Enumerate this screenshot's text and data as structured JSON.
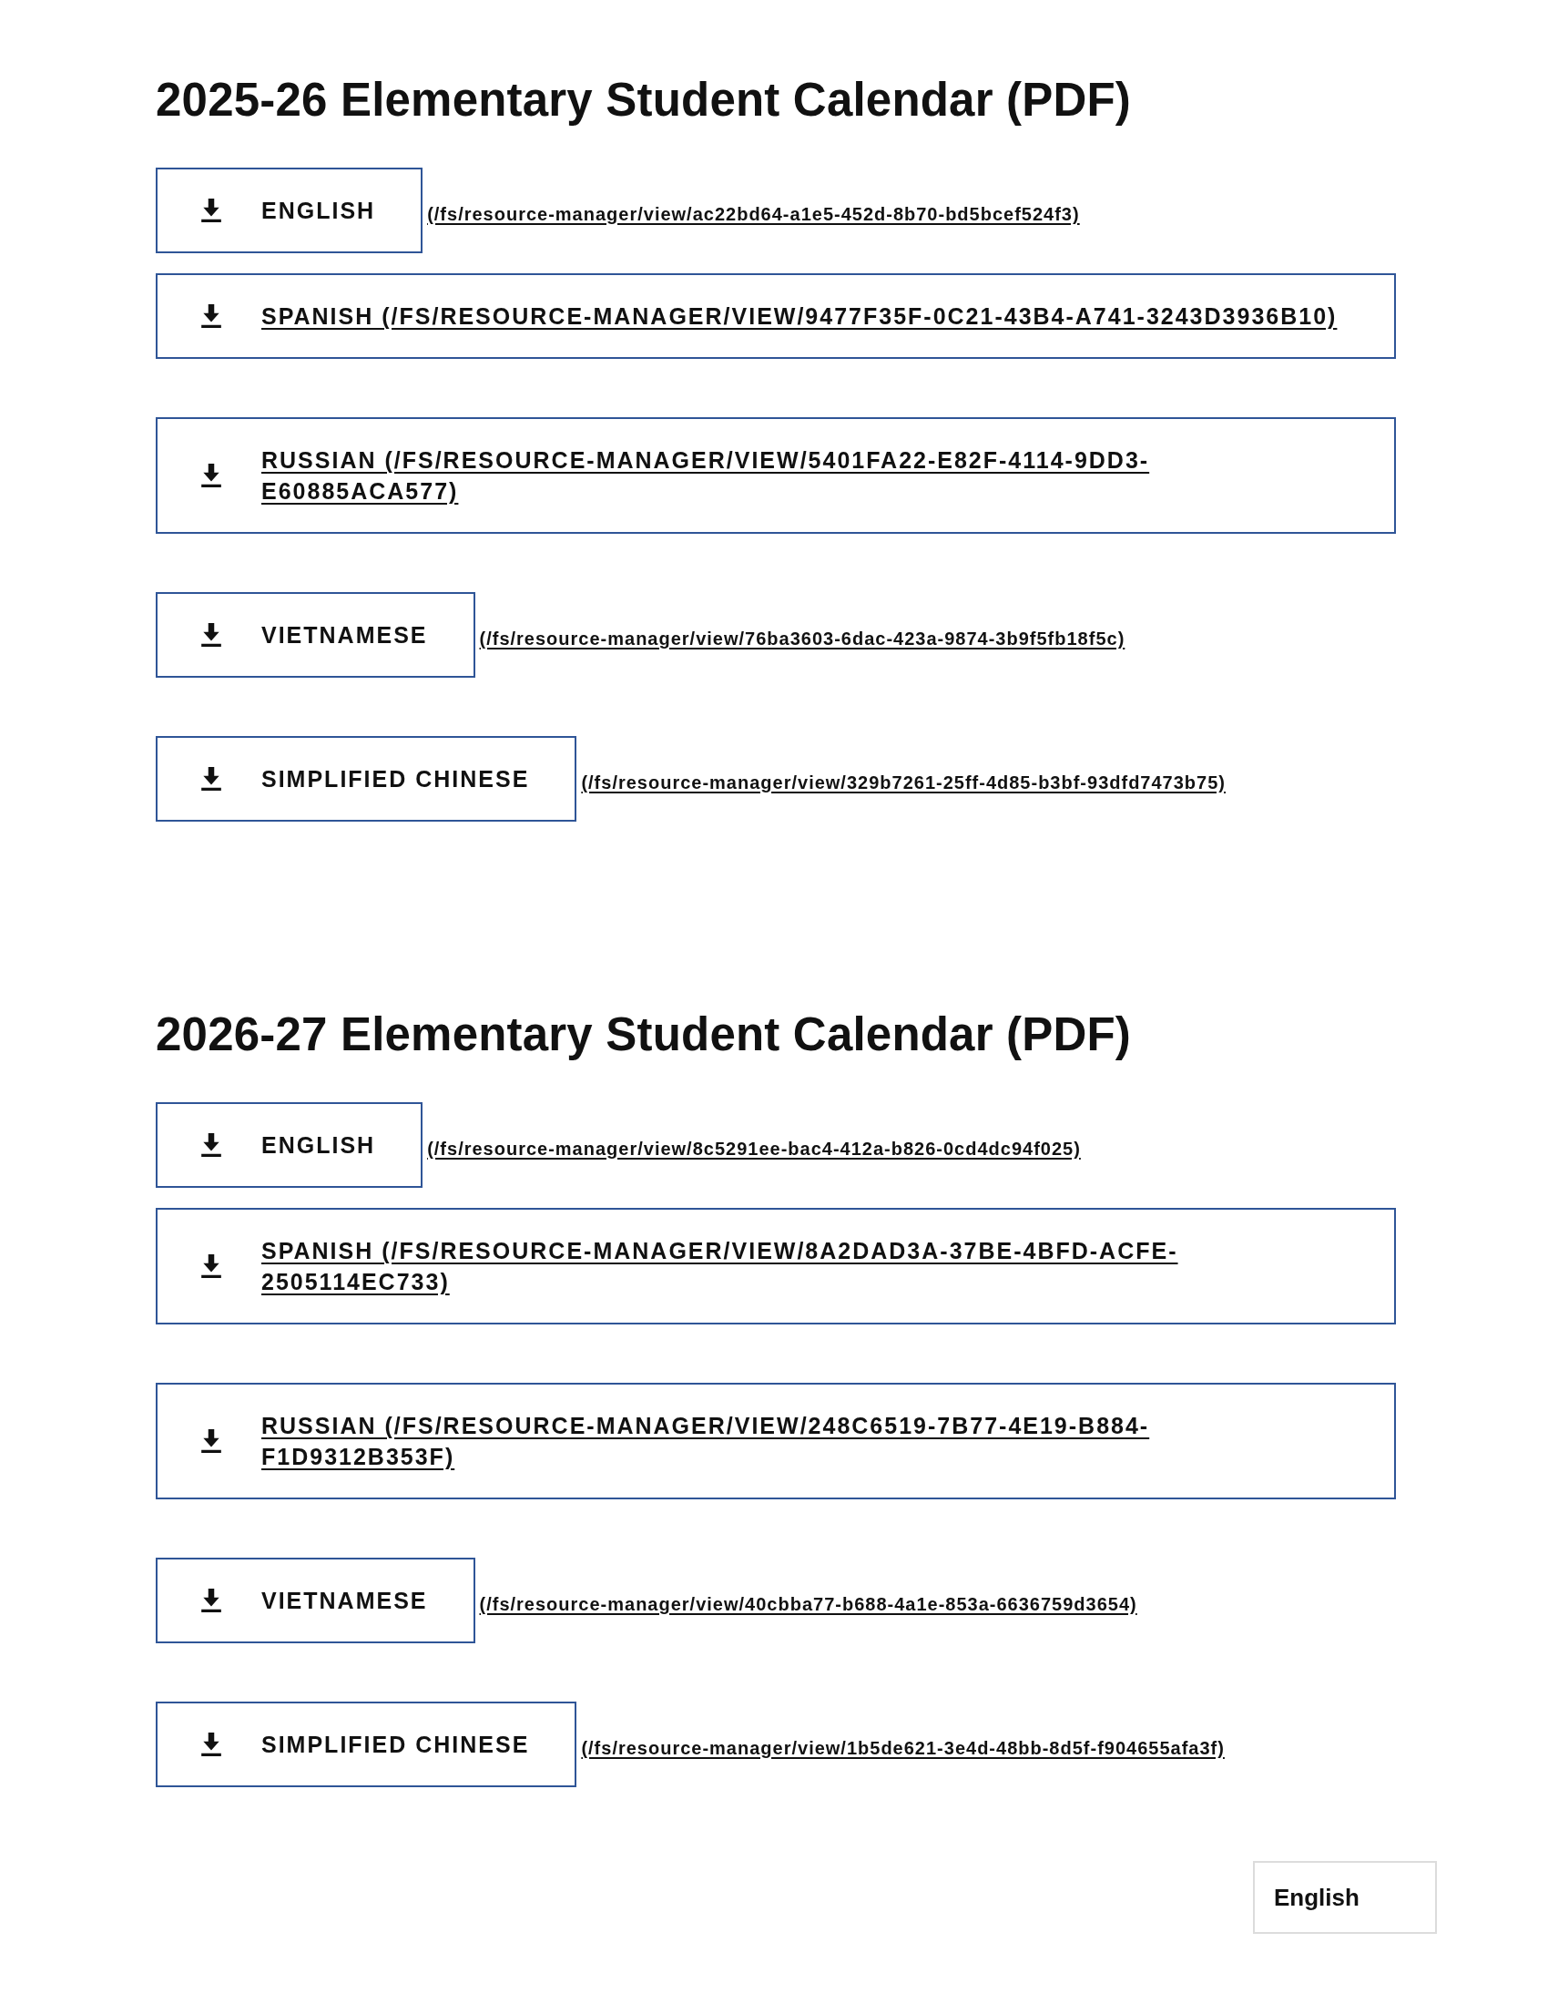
{
  "sections": [
    {
      "title": "2025-26 Elementary Student Calendar (PDF)",
      "groups": [
        {
          "links": [
            {
              "kind": "compact",
              "label": "ENGLISH",
              "url": "(/fs/resource-manager/view/ac22bd64-a1e5-452d-8b70-bd5bcef524f3)"
            },
            {
              "kind": "wide",
              "label": "SPANISH",
              "url": "(/FS/RESOURCE-MANAGER/VIEW/9477F35F-0C21-43B4-A741-3243D3936B10)"
            }
          ]
        },
        {
          "links": [
            {
              "kind": "wide",
              "label": "RUSSIAN",
              "url": "(/FS/RESOURCE-MANAGER/VIEW/5401FA22-E82F-4114-9DD3-E60885ACA577)"
            }
          ]
        },
        {
          "links": [
            {
              "kind": "compact",
              "label": "VIETNAMESE",
              "url": "(/fs/resource-manager/view/76ba3603-6dac-423a-9874-3b9f5fb18f5c)"
            }
          ]
        },
        {
          "links": [
            {
              "kind": "compact",
              "label": "SIMPLIFIED CHINESE",
              "url": "(/fs/resource-manager/view/329b7261-25ff-4d85-b3bf-93dfd7473b75)"
            }
          ]
        }
      ]
    },
    {
      "title": "2026-27 Elementary Student Calendar (PDF)",
      "groups": [
        {
          "links": [
            {
              "kind": "compact",
              "label": "ENGLISH",
              "url": "(/fs/resource-manager/view/8c5291ee-bac4-412a-b826-0cd4dc94f025)"
            },
            {
              "kind": "wide",
              "label": "SPANISH",
              "url": "(/FS/RESOURCE-MANAGER/VIEW/8A2DAD3A-37BE-4BFD-ACFE-2505114EC733)"
            }
          ]
        },
        {
          "links": [
            {
              "kind": "wide",
              "label": "RUSSIAN",
              "url": "(/FS/RESOURCE-MANAGER/VIEW/248C6519-7B77-4E19-B884-F1D9312B353F)"
            }
          ]
        },
        {
          "links": [
            {
              "kind": "compact",
              "label": "VIETNAMESE",
              "url": "(/fs/resource-manager/view/40cbba77-b688-4a1e-853a-6636759d3654)"
            }
          ]
        },
        {
          "links": [
            {
              "kind": "compact",
              "label": "SIMPLIFIED CHINESE",
              "url": "(/fs/resource-manager/view/1b5de621-3e4d-48bb-8d5f-f904655afa3f)"
            }
          ]
        }
      ]
    }
  ],
  "language_select": {
    "value": "English"
  }
}
